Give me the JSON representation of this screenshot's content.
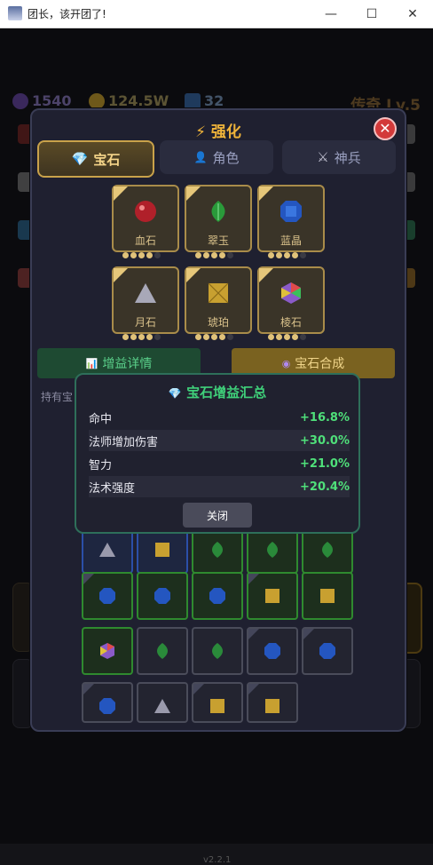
{
  "window": {
    "title": "团长，该开团了!",
    "min": "—",
    "max": "☐",
    "close": "✕"
  },
  "resources": {
    "crystal": "1540",
    "gold": "124.5W",
    "ticket": "32"
  },
  "rank": "传奇 Lv.5",
  "panel": {
    "title": "⚡ 强化",
    "close": "✕"
  },
  "tabs": [
    {
      "label": "宝石",
      "icon": "gem-icon"
    },
    {
      "label": "角色",
      "icon": "person-icon"
    },
    {
      "label": "神兵",
      "icon": "swords-icon"
    }
  ],
  "gems": [
    {
      "name": "血石",
      "filled": 4,
      "total": 5,
      "color": "#c0282e"
    },
    {
      "name": "翠玉",
      "filled": 4,
      "total": 5,
      "color": "#2a8a3a"
    },
    {
      "name": "蓝晶",
      "filled": 4,
      "total": 5,
      "color": "#2456b8"
    },
    {
      "name": "月石",
      "filled": 4,
      "total": 5,
      "color": "#b8b8c8"
    },
    {
      "name": "琥珀",
      "filled": 4,
      "total": 5,
      "color": "#c8a03a"
    },
    {
      "name": "棱石",
      "filled": 4,
      "total": 5,
      "color": "#8a5ac8"
    }
  ],
  "buttons": {
    "details": "增益详情",
    "combine": "宝石合成"
  },
  "inventory_label": "持有宝",
  "modal": {
    "title": "宝石增益汇总",
    "rows": [
      {
        "stat": "命中",
        "value": "+16.8%"
      },
      {
        "stat": "法师增加伤害",
        "value": "+30.0%"
      },
      {
        "stat": "智力",
        "value": "+21.0%"
      },
      {
        "stat": "法术强度",
        "value": "+20.4%"
      }
    ],
    "close": "关闭"
  },
  "version": "v2.2.1"
}
